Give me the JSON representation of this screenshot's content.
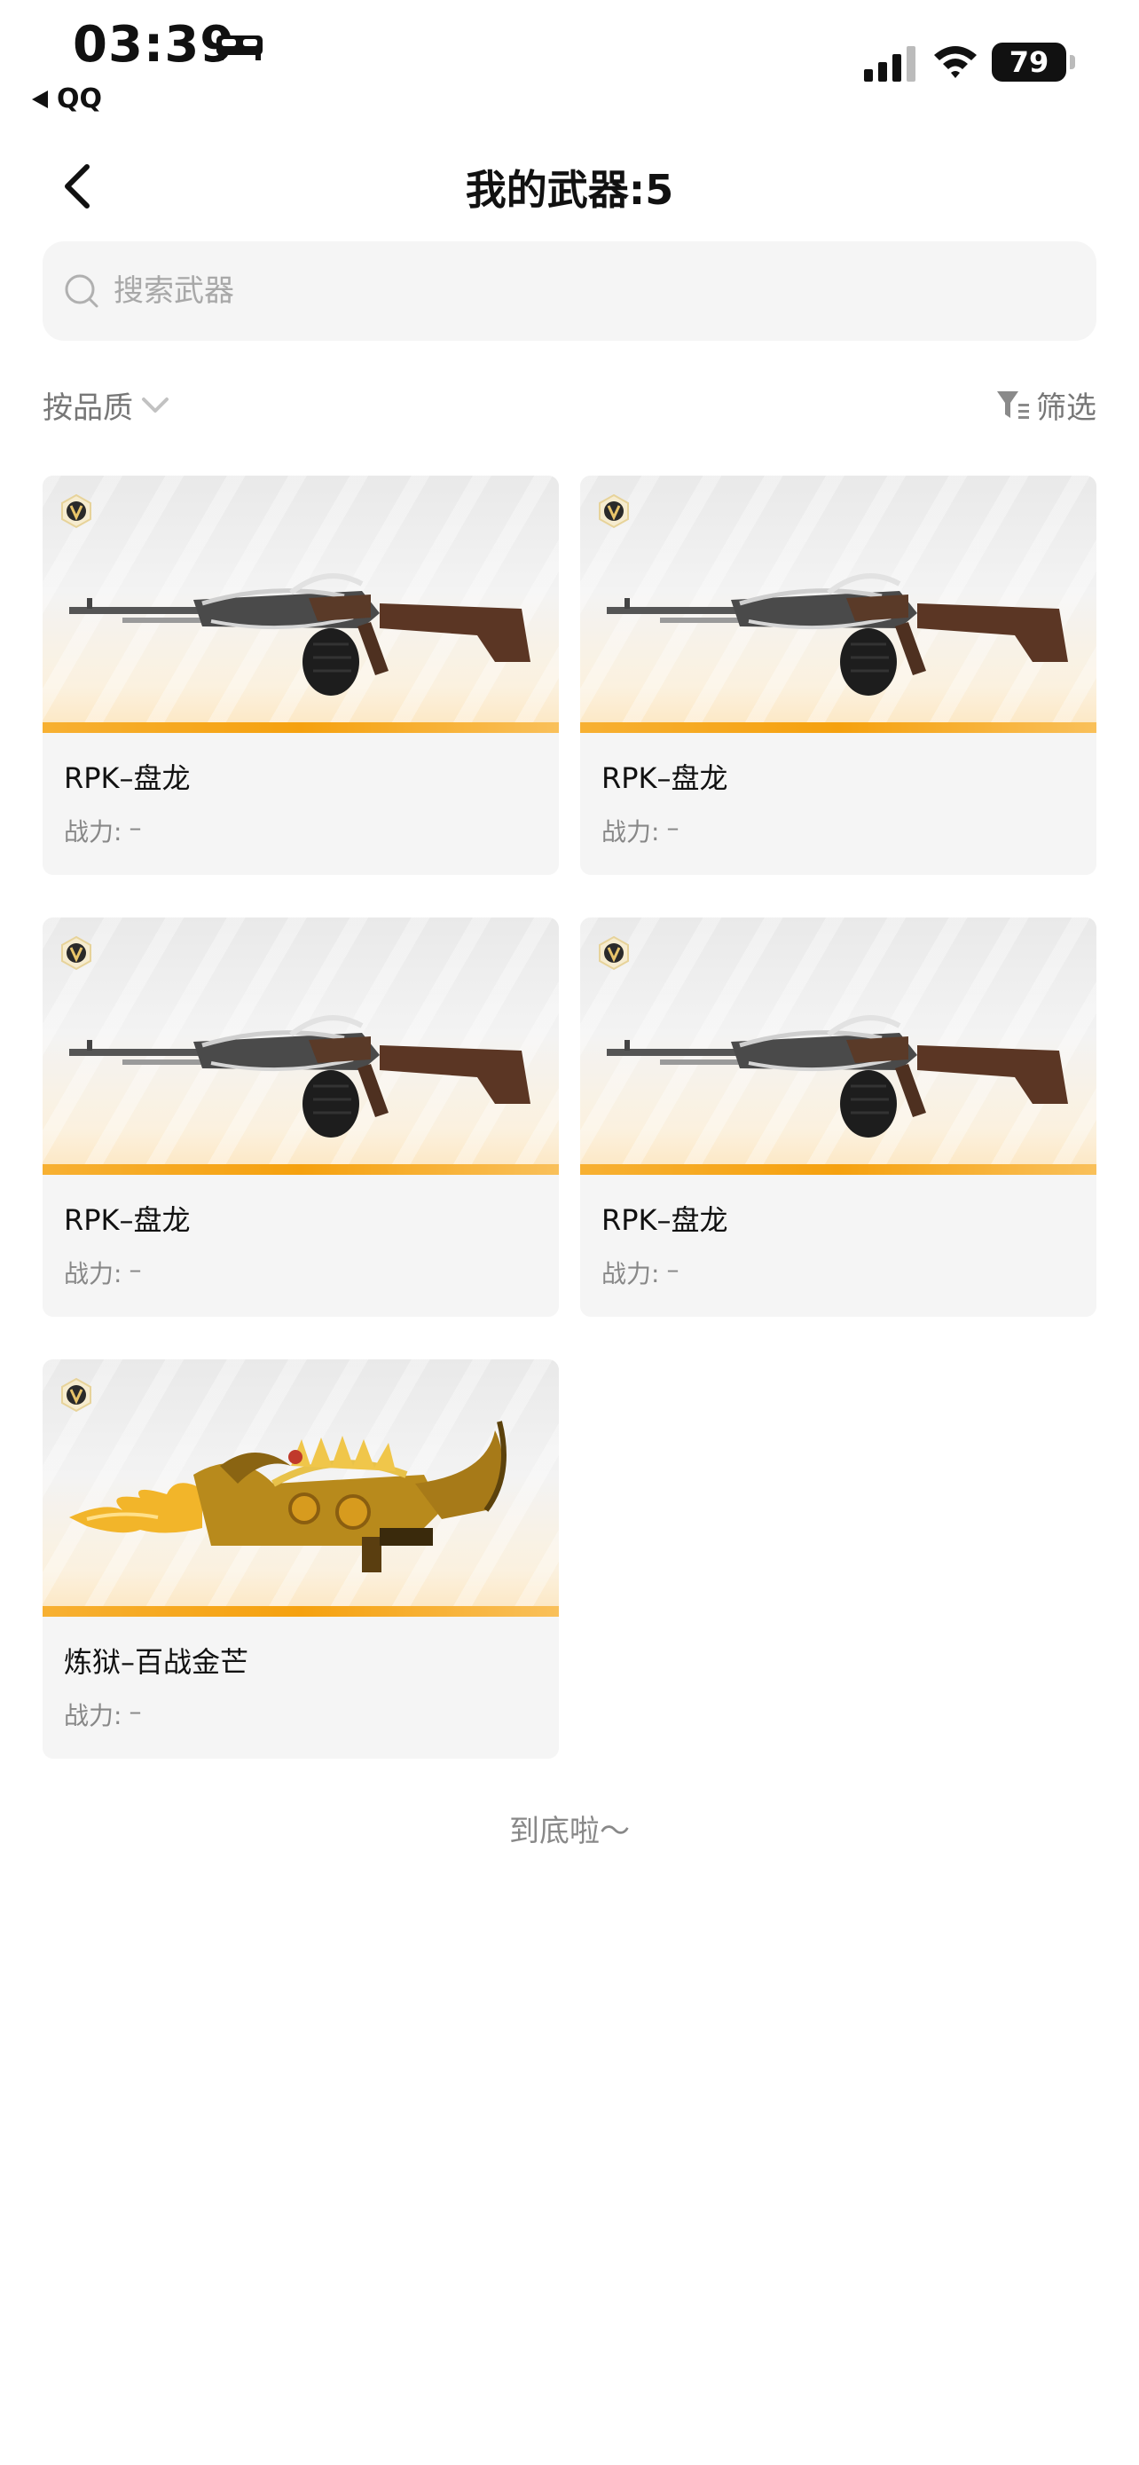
{
  "status_bar": {
    "time": "03:39",
    "app_back": "QQ",
    "battery": "79"
  },
  "nav": {
    "title": "我的武器:5"
  },
  "search": {
    "placeholder": "搜索武器"
  },
  "toolbar": {
    "sort_label": "按品质",
    "filter_label": "筛选"
  },
  "weapons": [
    {
      "name": "RPK–盘龙",
      "power_label": "战力:",
      "power_value": "–",
      "type": "rpk"
    },
    {
      "name": "RPK–盘龙",
      "power_label": "战力:",
      "power_value": "–",
      "type": "rpk"
    },
    {
      "name": "RPK–盘龙",
      "power_label": "战力:",
      "power_value": "–",
      "type": "rpk"
    },
    {
      "name": "RPK–盘龙",
      "power_label": "战力:",
      "power_value": "–",
      "type": "rpk"
    },
    {
      "name": "炼狱–百战金芒",
      "power_label": "战力:",
      "power_value": "–",
      "type": "gold"
    }
  ],
  "footer": {
    "end_text": "到底啦～"
  },
  "colors": {
    "accent_bar": "#f5a10f",
    "card_bg": "#f5f5f5"
  }
}
